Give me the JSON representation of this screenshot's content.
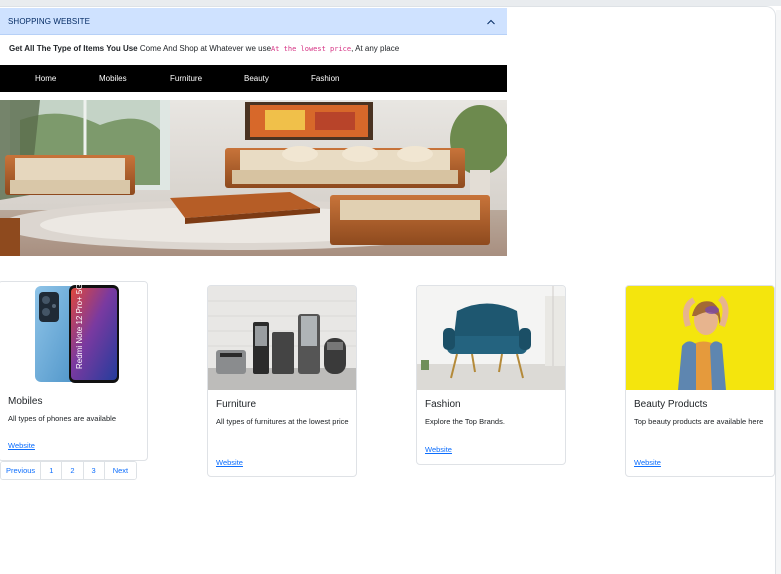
{
  "accordion": {
    "title": "SHOPPING WEBSITE"
  },
  "tagline": {
    "bold": "Get All The Type of Items You Use",
    "text": " Come And Shop at Whatever we use",
    "code": "At the lowest price",
    "tail": ", At any place"
  },
  "nav": {
    "items": [
      {
        "label": "Home"
      },
      {
        "label": "Mobiles"
      },
      {
        "label": "Furniture"
      },
      {
        "label": "Beauty"
      },
      {
        "label": "Fashion"
      }
    ]
  },
  "hero": {
    "image": "living-room-sofa-set"
  },
  "cards": [
    {
      "title": "Mobiles",
      "text": "All types of phones are available",
      "link": "Website",
      "image": "redmi-phone",
      "phone_text": "Redmi Note 12 Pro+ 5G"
    },
    {
      "title": "Furniture",
      "text": "All types of furnitures at the lowest price",
      "link": "Website",
      "image": "kitchen-appliances"
    },
    {
      "title": "Fashion",
      "text": "Explore the Top Brands.",
      "link": "Website",
      "image": "blue-armchair"
    },
    {
      "title": "Beauty Products",
      "text": "Top beauty products are available here",
      "link": "Website",
      "image": "woman-yellow-background"
    }
  ],
  "pagination": {
    "previous": "Previous",
    "pages": [
      "1",
      "2",
      "3"
    ],
    "next": "Next"
  },
  "colors": {
    "accordion_bg": "#cfe2ff",
    "navbar_bg": "#000000",
    "link": "#0d6efd",
    "code": "#d63384",
    "beauty_bg": "#f5e60a"
  }
}
